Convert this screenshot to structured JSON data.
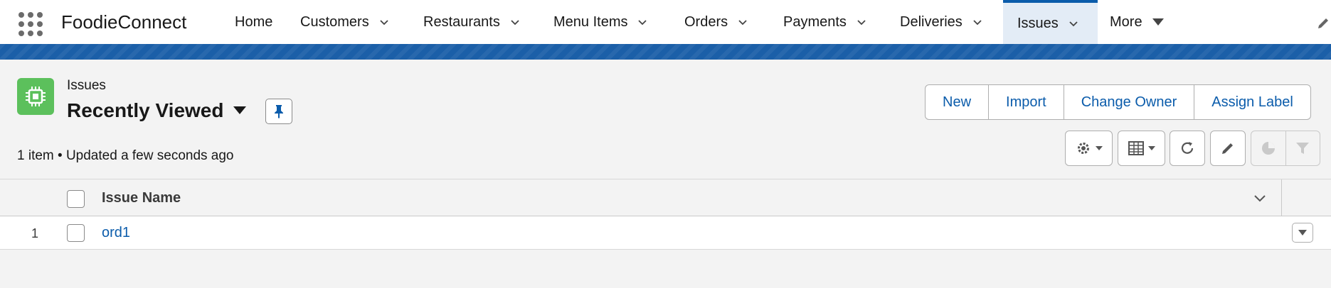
{
  "app": {
    "name": "FoodieConnect"
  },
  "nav": {
    "items": [
      {
        "label": "Home"
      },
      {
        "label": "Customers"
      },
      {
        "label": "Restaurants"
      },
      {
        "label": "Menu Items"
      },
      {
        "label": "Orders"
      },
      {
        "label": "Payments"
      },
      {
        "label": "Deliveries"
      },
      {
        "label": "Issues"
      },
      {
        "label": "More"
      }
    ],
    "active": "Issues"
  },
  "list": {
    "object_label": "Issues",
    "view_title": "Recently Viewed",
    "status": "1 item • Updated a few seconds ago",
    "actions": [
      "New",
      "Import",
      "Change Owner",
      "Assign Label"
    ]
  },
  "table": {
    "columns": [
      {
        "label": "Issue Name"
      }
    ],
    "rows": [
      {
        "num": "1",
        "name": "ord1"
      }
    ]
  },
  "icons": {
    "app_launcher": "waffle-grid-icon",
    "object": "chip-icon",
    "pin": "pin-icon",
    "settings": "gear-icon",
    "display": "table-icon",
    "refresh": "refresh-icon",
    "edit": "pencil-icon",
    "chart": "pie-chart-icon",
    "filter": "filter-icon"
  },
  "colors": {
    "brand_band": "#1b5fa8",
    "link": "#0b5cab",
    "object_icon": "#5cc05c",
    "active_tab_bg": "#e3ecf6"
  }
}
